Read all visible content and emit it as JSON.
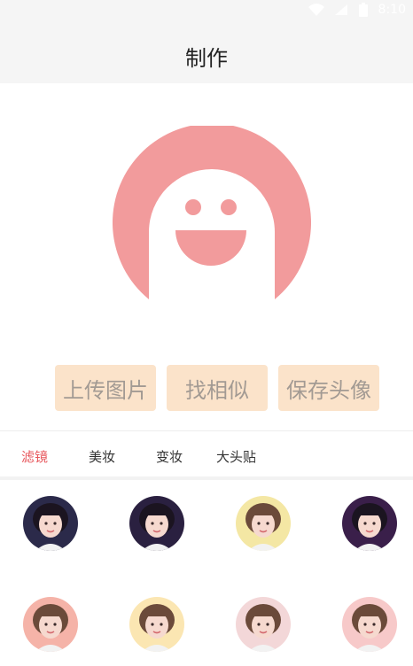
{
  "status_bar": {
    "time": "8:10",
    "icons": [
      "wifi-icon",
      "signal-icon",
      "battery-icon"
    ]
  },
  "header": {
    "title": "制作"
  },
  "preview": {
    "icon": "smiley-mascot-icon",
    "color": "#f29b9c"
  },
  "actions": {
    "upload_label": "上传图片",
    "similar_label": "找相似",
    "save_label": "保存头像"
  },
  "tabs": [
    {
      "label": "滤镜",
      "active": true
    },
    {
      "label": "美妆",
      "active": false
    },
    {
      "label": "变妆",
      "active": false
    },
    {
      "label": "大头贴",
      "active": false
    }
  ],
  "colors": {
    "accent": "#e7575c",
    "button_bg": "#fbe3ca",
    "button_text": "#a29a93",
    "header_bg": "#f5f5f5"
  },
  "filters": [
    {
      "icon": "portrait-avatar-icon",
      "bg": "#2b2a4a"
    },
    {
      "icon": "portrait-avatar-icon",
      "bg": "#2a2040"
    },
    {
      "icon": "portrait-avatar-icon",
      "bg": "#f4e7a4"
    },
    {
      "icon": "portrait-avatar-icon",
      "bg": "#3a1f4a"
    },
    {
      "icon": "portrait-avatar-icon",
      "bg": "#f5b3a8"
    },
    {
      "icon": "portrait-avatar-icon",
      "bg": "#fbe6b2"
    },
    {
      "icon": "portrait-avatar-icon",
      "bg": "#f3d7d8"
    },
    {
      "icon": "portrait-avatar-icon",
      "bg": "#f7c9c9"
    }
  ]
}
